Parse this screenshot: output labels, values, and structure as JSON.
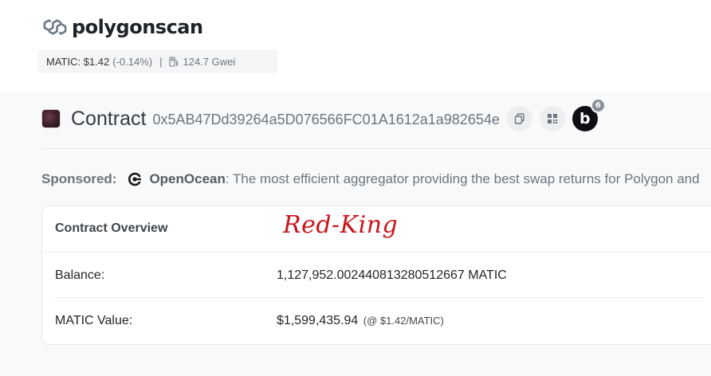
{
  "brand": {
    "name": "polygonscan",
    "logo_icon": "polygon-logo-icon"
  },
  "price_bar": {
    "matic_price": "MATIC: $1.42",
    "change": "(-0.14%)",
    "separator": "|",
    "gas": "124.7 Gwei",
    "gas_icon": "gas-pump-icon"
  },
  "contract": {
    "title": "Contract",
    "address": "0x5AB47Dd39264a5D076566FC01A1612a1a982654e",
    "copy_icon": "copy-icon",
    "qr_icon": "qr-code-icon",
    "blockscan_label": "b",
    "blockscan_count": "6"
  },
  "sponsor": {
    "label": "Sponsored:",
    "name": "OpenOcean",
    "text": ": The most efficient aggregator providing the best swap returns for Polygon and"
  },
  "overview": {
    "title": "Contract Overview",
    "watermark": "Red-King",
    "balance_label": "Balance:",
    "balance_value": "1,127,952.002440813280512667 MATIC",
    "value_label": "MATIC Value:",
    "value_amount": "$1,599,435.94",
    "value_rate": "(@ $1.42/MATIC)"
  },
  "colors": {
    "watermark": "#c8151b",
    "blockscan_bg": "#0d0d14",
    "page_bg": "#f8f9fa"
  }
}
